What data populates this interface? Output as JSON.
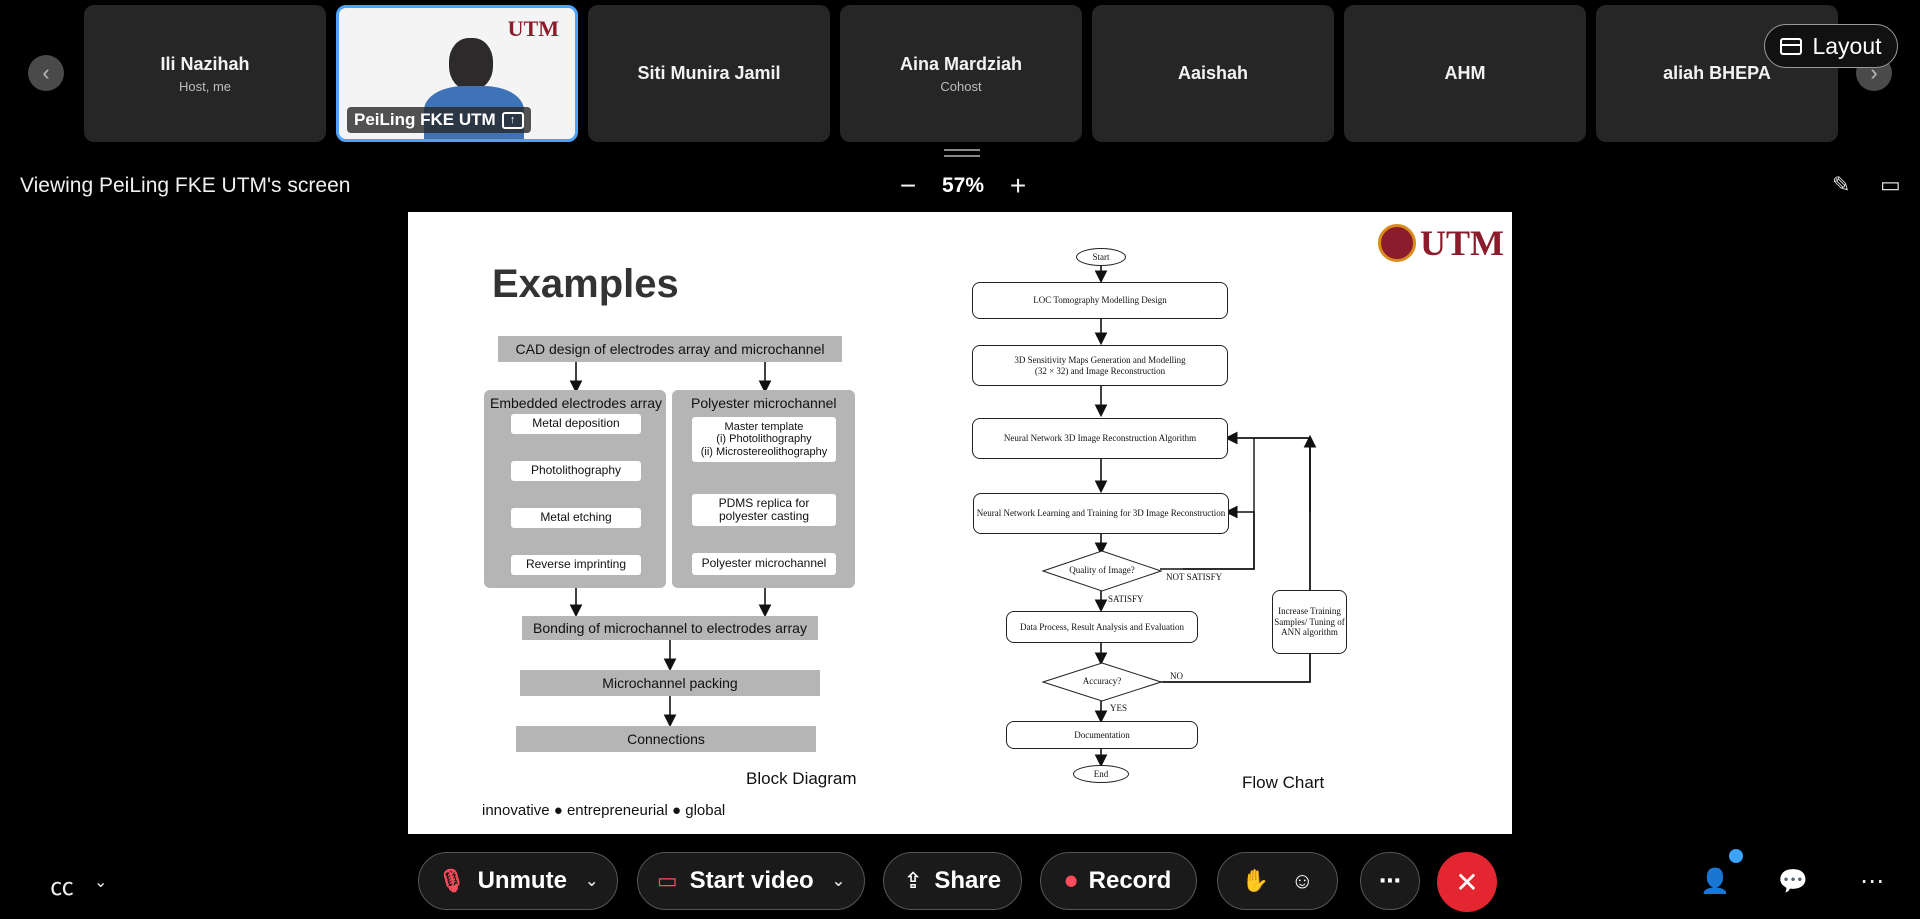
{
  "participants": [
    {
      "name": "Ili Nazihah",
      "role": "Host, me"
    },
    {
      "name": "PeiLing FKE UTM",
      "role": "",
      "sharing": true
    },
    {
      "name": "Siti Munira Jamil",
      "role": ""
    },
    {
      "name": "Aina Mardziah",
      "role": "Cohost"
    },
    {
      "name": "Aaishah",
      "role": ""
    },
    {
      "name": "AHM",
      "role": ""
    },
    {
      "name": "aliah BHEPA",
      "role": ""
    }
  ],
  "layout_label": "Layout",
  "tile_logo": "UTM",
  "viewing_text": "Viewing PeiLing FKE UTM's screen",
  "zoom": {
    "minus": "−",
    "value": "57%",
    "plus": "+"
  },
  "slide": {
    "title": "Examples",
    "logo_text": "UTM",
    "tagline": "innovative ● entrepreneurial ● global",
    "block_diagram": {
      "label": "Block Diagram",
      "top": "CAD design of electrodes array and microchannel",
      "left_title": "Embedded electrodes array",
      "left_steps": [
        "Metal deposition",
        "Photolithography",
        "Metal etching",
        "Reverse imprinting"
      ],
      "right_title": "Polyester microchannel",
      "right_steps": [
        "Master template\n(i) Photolithography\n(ii) Microstereolithography",
        "PDMS replica for\npolyester casting",
        "Polyester microchannel"
      ],
      "bonding": "Bonding of microchannel to electrodes array",
      "packing": "Microchannel packing",
      "connections": "Connections"
    },
    "flow_chart": {
      "label": "Flow Chart",
      "start": "Start",
      "step1": "LOC Tomography Modelling Design",
      "step2": "3D Sensitivity Maps Generation and Modelling\n(32 × 32) and Image Reconstruction",
      "step3": "Neural Network 3D Image Reconstruction Algorithm",
      "step4": "Neural Network Learning and Training for 3D Image Reconstruction",
      "decision1": "Quality of Image?",
      "not_satisfy": "NOT SATISFY",
      "satisfy": "SATISFY",
      "step5": "Data Process, Result Analysis and Evaluation",
      "side_box": "Increase Training\nSamples/ Tuning of\nANN algorithm",
      "decision2": "Accuracy?",
      "no": "NO",
      "yes": "YES",
      "step6": "Documentation",
      "end": "End"
    }
  },
  "controls": {
    "unmute": "Unmute",
    "start_video": "Start video",
    "share": "Share",
    "record": "Record"
  },
  "colors": {
    "accent_blue": "#4aa3ff",
    "end_red": "#e3262f",
    "mute_red": "#ff4d5e",
    "utm_maroon": "#8a1c2b"
  }
}
